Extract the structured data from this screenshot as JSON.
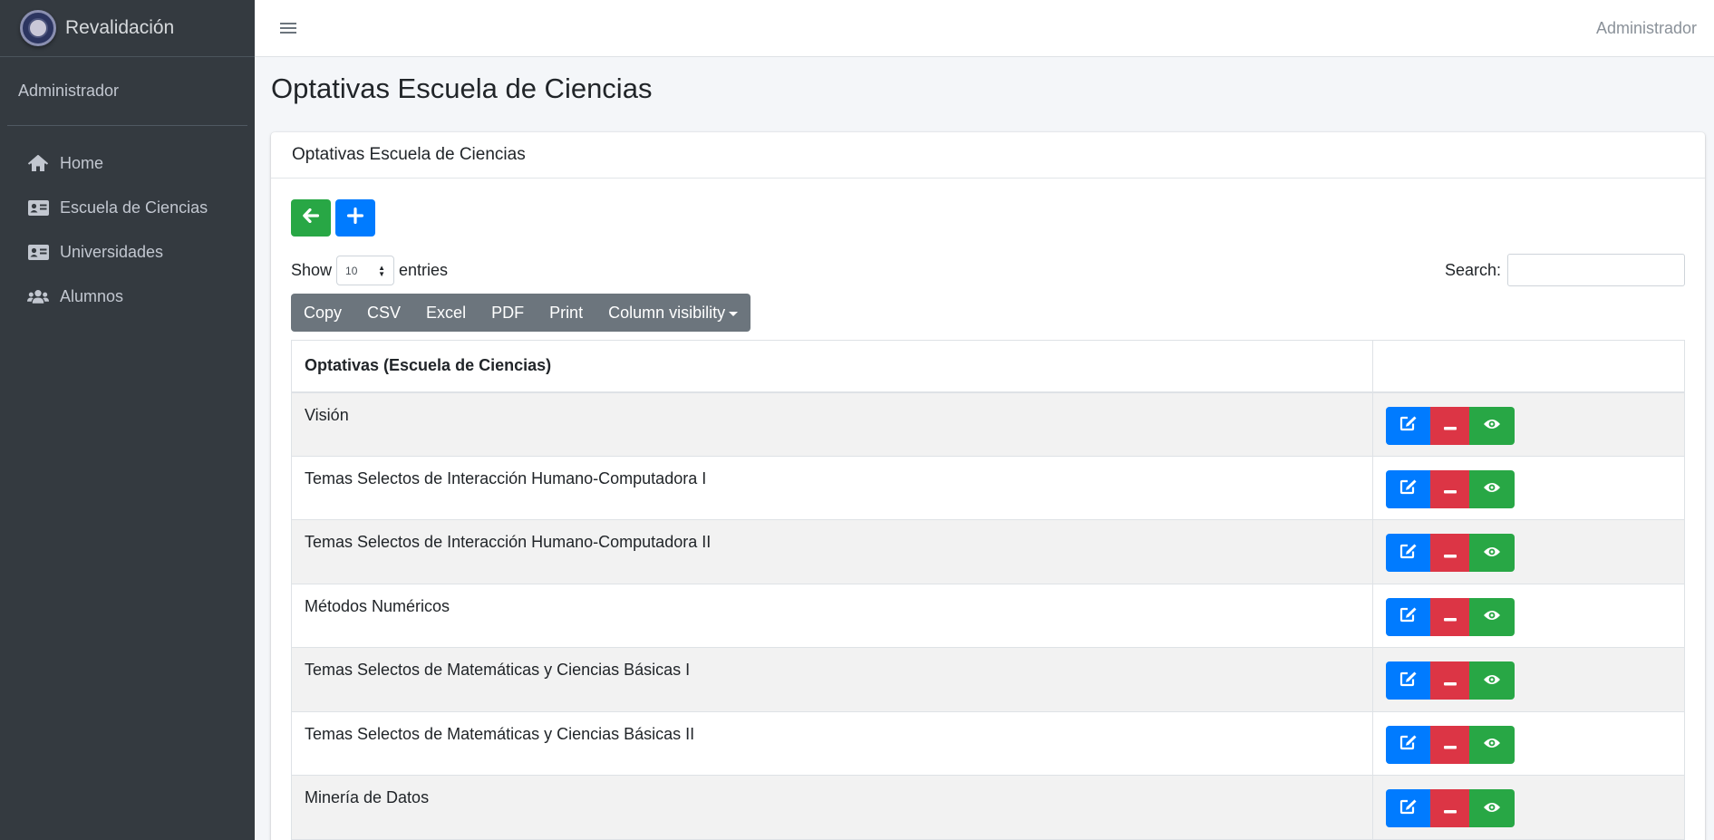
{
  "brand": {
    "title": "Revalidación"
  },
  "sidebar": {
    "user": "Administrador",
    "items": [
      {
        "label": "Home",
        "icon": "home-icon"
      },
      {
        "label": "Escuela de Ciencias",
        "icon": "id-card-icon"
      },
      {
        "label": "Universidades",
        "icon": "id-card-icon"
      },
      {
        "label": "Alumnos",
        "icon": "users-icon"
      }
    ]
  },
  "topbar": {
    "user": "Administrador"
  },
  "page": {
    "title": "Optativas Escuela de Ciencias"
  },
  "card": {
    "header": "Optativas Escuela de Ciencias"
  },
  "datatable": {
    "show_label": "Show",
    "entries_value": "10",
    "entries_label": "entries",
    "search_label": "Search:",
    "search_value": "",
    "buttons": [
      "Copy",
      "CSV",
      "Excel",
      "PDF",
      "Print",
      "Column visibility"
    ],
    "column_header": "Optativas (Escuela de Ciencias)",
    "actions_header": "",
    "rows": [
      "Visión",
      "Temas Selectos de Interacción Humano-Computadora I",
      "Temas Selectos de Interacción Humano-Computadora II",
      "Métodos Numéricos",
      "Temas Selectos de Matemáticas y Ciencias Básicas I",
      "Temas Selectos de Matemáticas y Ciencias Básicas II",
      "Minería de Datos"
    ]
  },
  "colors": {
    "sidebar": "#343a40",
    "primary": "#007bff",
    "success": "#28a745",
    "danger": "#dc3545",
    "secondary": "#6c757d"
  }
}
